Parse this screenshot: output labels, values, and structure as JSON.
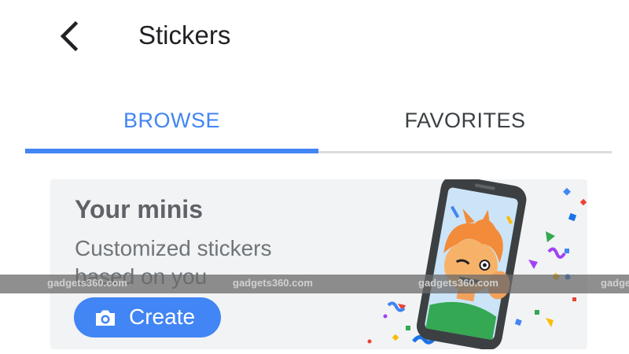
{
  "header": {
    "title": "Stickers",
    "back_icon": "chevron-left-icon"
  },
  "tabs": [
    {
      "label": "BROWSE",
      "active": true
    },
    {
      "label": "FAVORITES",
      "active": false
    }
  ],
  "card": {
    "title": "Your minis",
    "subtitle": "Customized stickers based on you",
    "button": {
      "label": "Create",
      "icon": "camera-icon"
    },
    "illustration": "selfie-phone-sticker"
  },
  "watermark": [
    "gadgets360.com",
    "gadgets360.com",
    "gadgets360.com",
    "gadge"
  ],
  "colors": {
    "accent": "#4285f4",
    "card_bg": "#f1f3f4",
    "text_primary": "#202124",
    "text_secondary": "#70757a"
  }
}
